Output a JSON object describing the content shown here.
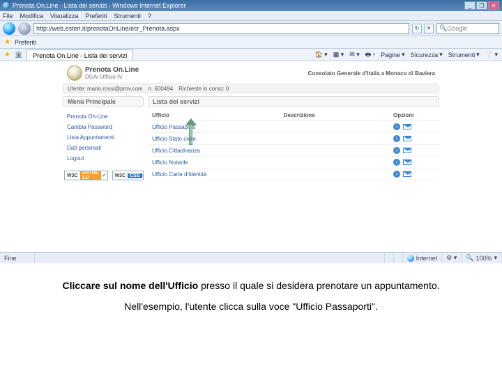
{
  "ie": {
    "title": "Prenota On.Line - Lista dei servizi - Windows Internet Explorer",
    "menu": [
      "File",
      "Modifica",
      "Visualizza",
      "Preferiti",
      "Strumenti",
      "?"
    ],
    "url": "http://web.esteri.it/prenotaOnLine/ecr_Prenota.aspx",
    "search_placeholder": "Google",
    "fav_label": "Preferiti",
    "fav_item": "Prenota On.Line - Lista dei servizi",
    "tab_label": "Prenota On.Line - Lista dei servizi",
    "toolbar_items": [
      "Pagine",
      "Sicurezza",
      "Strumenti"
    ],
    "status_done": "Fine",
    "status_zone": "Internet",
    "status_zoom": "100%"
  },
  "brand": {
    "title": "Prenota On.Line",
    "sub": "DGAI Ufficio IV",
    "consulate": "Consolato Generale d'Italia a Monaco di Baviera"
  },
  "userbar": {
    "user_label": "Utente: mario.rossi@prov.com",
    "code_label": "n. 600494",
    "pending_label": "Richieste in corso: 0"
  },
  "left_panel": {
    "title": "Menù Principale",
    "items": [
      "Prenota On-Line",
      "Cambia Password",
      "Lista Appuntamenti",
      "Dati personali",
      "Logout"
    ]
  },
  "right_panel": {
    "title": "Lista dei servizi",
    "cols": {
      "ufficio": "Ufficio",
      "descrizione": "Descrizione",
      "opzioni": "Opzioni"
    },
    "rows": [
      {
        "name": "Ufficio Passaporti"
      },
      {
        "name": "Ufficio Stato civile"
      },
      {
        "name": "Ufficio Cittadinanza"
      },
      {
        "name": "Ufficio Notarile"
      },
      {
        "name": "Ufficio Carte d'Identità"
      }
    ]
  },
  "badges": {
    "w3c": "W3C",
    "xhtml": "XHTML 1.0",
    "css": "CSS"
  },
  "caption": {
    "bold": "Cliccare sul nome dell'Ufficio",
    "rest": " presso il quale si desidera prenotare un appuntamento.",
    "line2": "Nell'esempio, l'utente clicca sulla voce \"Ufficio Passaporti\"."
  }
}
